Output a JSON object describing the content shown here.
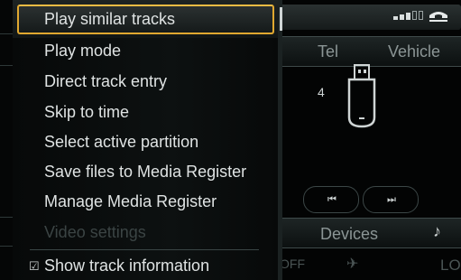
{
  "menu": {
    "items": [
      {
        "label": "Play similar tracks",
        "state": "selected"
      },
      {
        "label": "Play mode",
        "state": "normal"
      },
      {
        "label": "Direct track entry",
        "state": "normal"
      },
      {
        "label": "Skip to time",
        "state": "normal"
      },
      {
        "label": "Select active partition",
        "state": "normal"
      },
      {
        "label": "Save files to Media Register",
        "state": "normal"
      },
      {
        "label": "Manage Media Register",
        "state": "normal"
      },
      {
        "label": "Video settings",
        "state": "disabled"
      },
      {
        "label": "Show track information",
        "state": "checked"
      }
    ]
  },
  "background": {
    "tabs": {
      "tel": "Tel",
      "vehicle": "Vehicle"
    },
    "track_number": "4",
    "controls": {
      "prev": "⏮",
      "next": "⏭"
    },
    "devices": "Devices",
    "bottom": {
      "lo": "LO",
      "off": "OFF"
    }
  },
  "colors": {
    "accent": "#e0a830",
    "text": "#dfe3e3",
    "disabled": "#3b4444"
  }
}
